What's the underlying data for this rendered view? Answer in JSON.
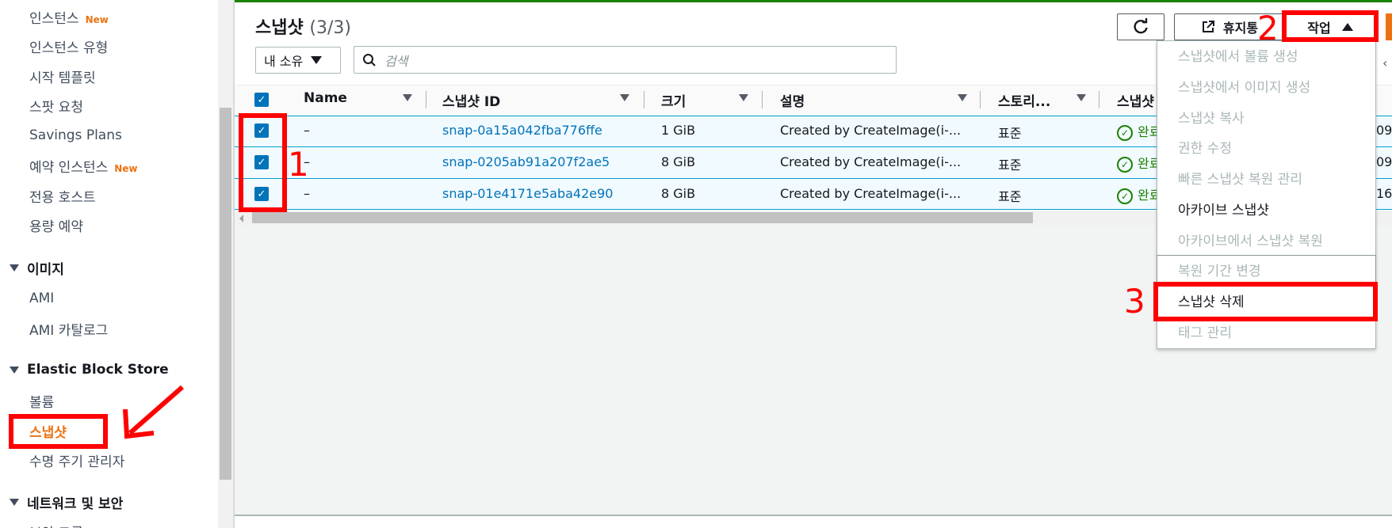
{
  "sidebar": {
    "items": [
      {
        "label": "인스턴스",
        "badge": "New"
      },
      {
        "label": "인스턴스 유형"
      },
      {
        "label": "시작 템플릿"
      },
      {
        "label": "스팟 요청"
      },
      {
        "label": "Savings Plans"
      },
      {
        "label": "예약 인스턴스",
        "badge": "New"
      },
      {
        "label": "전용 호스트"
      },
      {
        "label": "용량 예약"
      }
    ],
    "sections": [
      {
        "title": "이미지",
        "items": [
          "AMI",
          "AMI 카탈로그"
        ]
      },
      {
        "title": "Elastic Block Store",
        "items": [
          "볼륨",
          "스냅샷",
          "수명 주기 관리자"
        ]
      },
      {
        "title": "네트워크 및 보안",
        "items": [
          "보안 그룹"
        ]
      }
    ],
    "active_item": "스냅샷"
  },
  "header": {
    "title": "스냅샷",
    "count": "(3/3)",
    "refresh_icon": "refresh-icon",
    "recycle_bin_label": "휴지통",
    "actions_label": "작업"
  },
  "filter": {
    "owner_label": "내 소유",
    "search_placeholder": "검색"
  },
  "table": {
    "columns": [
      "Name",
      "스냅샷 ID",
      "크기",
      "설명",
      "스토리...",
      "스냅샷"
    ],
    "rows": [
      {
        "name": "–",
        "id": "snap-0a15a042fba776ffe",
        "size": "1 GiB",
        "description": "Created by CreateImage(i-...",
        "storage": "표준",
        "status": "완료",
        "extra": "09"
      },
      {
        "name": "–",
        "id": "snap-0205ab91a207f2ae5",
        "size": "8 GiB",
        "description": "Created by CreateImage(i-...",
        "storage": "표준",
        "status": "완료",
        "extra": "09"
      },
      {
        "name": "–",
        "id": "snap-01e4171e5aba42e90",
        "size": "8 GiB",
        "description": "Created by CreateImage(i-...",
        "storage": "표준",
        "status": "완료",
        "extra": "16"
      }
    ]
  },
  "actions_menu": {
    "items": [
      {
        "label": "스냅샷에서 볼륨 생성",
        "enabled": false
      },
      {
        "label": "스냅샷에서 이미지 생성",
        "enabled": false
      },
      {
        "label": "스냅샷 복사",
        "enabled": false
      },
      {
        "label": "권한 수정",
        "enabled": false
      },
      {
        "label": "빠른 스냅샷 복원 관리",
        "enabled": false
      },
      {
        "label": "아카이브 스냅샷",
        "enabled": true
      },
      {
        "label": "아카이브에서 스냅샷 복원",
        "enabled": false
      },
      {
        "label": "복원 기간 변경",
        "enabled": false
      },
      {
        "label": "스냅샷 삭제",
        "enabled": true
      },
      {
        "label": "태그 관리",
        "enabled": false
      }
    ]
  },
  "annotations": [
    "1",
    "2",
    "3"
  ],
  "colors": {
    "accent_orange": "#ec7211",
    "link_blue": "#0073bb",
    "success_green": "#1d8102",
    "annotation_red": "#ff0000"
  }
}
